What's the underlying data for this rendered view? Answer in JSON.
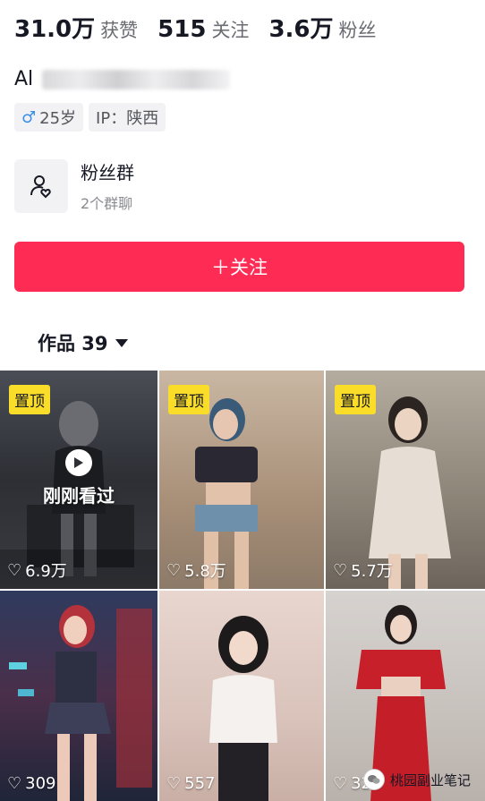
{
  "stats": [
    {
      "value": "31.0万",
      "label": "获赞"
    },
    {
      "value": "515",
      "label": "关注"
    },
    {
      "value": "3.6万",
      "label": "粉丝"
    }
  ],
  "profile": {
    "name_visible": "Al",
    "gender_icon": "♂",
    "age": "25岁",
    "ip": "IP：陕西"
  },
  "fan_group": {
    "title": "粉丝群",
    "subtitle": "2个群聊",
    "icon": "user-heart-icon"
  },
  "follow_button": "＋关注",
  "works_tab": {
    "label": "作品 39"
  },
  "videos": [
    {
      "pinned": true,
      "pin_label": "置顶",
      "likes": "6.9万",
      "watched": true,
      "watched_label": "刚刚看过"
    },
    {
      "pinned": true,
      "pin_label": "置顶",
      "likes": "5.8万",
      "watched": false
    },
    {
      "pinned": true,
      "pin_label": "置顶",
      "likes": "5.7万",
      "watched": false
    },
    {
      "pinned": false,
      "likes": "309"
    },
    {
      "pinned": false,
      "likes": "557"
    },
    {
      "pinned": false,
      "likes": "329"
    }
  ],
  "watermark": "桃园副业笔记",
  "colors": {
    "accent": "#fe2c55",
    "pin": "#fadd29"
  }
}
